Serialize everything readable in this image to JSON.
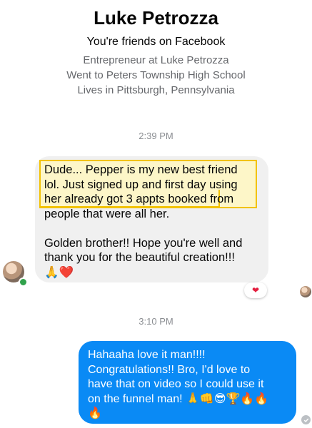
{
  "header": {
    "name": "Luke Petrozza",
    "friends_text": "You're friends on Facebook",
    "info": [
      "Entrepreneur at Luke Petrozza",
      "Went to Peters Township High School",
      "Lives in Pittsburgh, Pennsylvania"
    ]
  },
  "messages": {
    "time1": "2:39 PM",
    "incoming": {
      "line1": "Dude... Pepper is my new best friend",
      "line2": "lol. Just signed up and first day using",
      "line3a": "her already got 3 appts booked",
      "line3b": " from",
      "line4": "people that were all her.",
      "line5": "Golden brother!! Hope you're well and",
      "line6": "thank you for the beautiful creation!!!",
      "line7": "🙏❤️"
    },
    "reaction": "❤",
    "time2": "3:10 PM",
    "outgoing": {
      "line1": "Hahaaha love it man!!!!",
      "line2": "Congratulations!!  Bro, I'd love to",
      "line3": "have that on video so I could use it",
      "line4": "on the funnel man! 🙏👊😎🏆🔥🔥",
      "line5": "🔥"
    }
  },
  "colors": {
    "accent_blue": "#0a8af5",
    "highlight_border": "#f2c200",
    "online_green": "#31a24c"
  }
}
